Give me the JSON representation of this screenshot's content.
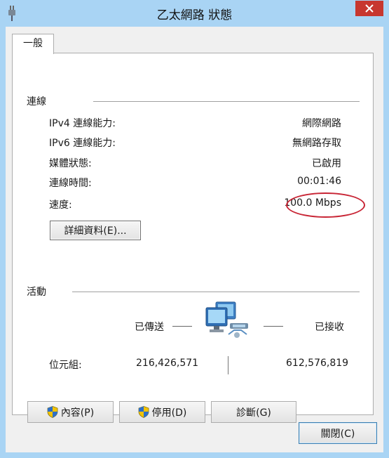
{
  "window": {
    "title": "乙太網路 狀態",
    "close_symbol": "✕"
  },
  "tabs": [
    {
      "label": "一般",
      "selected": true
    }
  ],
  "connection": {
    "heading": "連線",
    "rows": [
      {
        "label": "IPv4 連線能力:",
        "value": "網際網路"
      },
      {
        "label": "IPv6 連線能力:",
        "value": "無網路存取"
      },
      {
        "label": "媒體狀態:",
        "value": "已啟用"
      },
      {
        "label": "連線時間:",
        "value": "00:01:46"
      },
      {
        "label": "速度:",
        "value": "100.0 Mbps"
      }
    ],
    "details_button": "詳細資料(E)..."
  },
  "activity": {
    "heading": "活動",
    "sent_label": "已傳送",
    "received_label": "已接收",
    "bytes_label": "位元組:",
    "bytes_sent": "216,426,571",
    "bytes_received": "612,576,819"
  },
  "buttons": {
    "properties": "內容(P)",
    "disable": "停用(D)",
    "diagnose": "診斷(G)",
    "close": "關閉(C)"
  },
  "annotation": {
    "color": "#c82535"
  },
  "colors": {
    "titlebar": "#a9d4f4",
    "close_button": "#c7372f"
  },
  "icons": [
    "plug-icon",
    "network-computers-icon",
    "shield-icon"
  ]
}
